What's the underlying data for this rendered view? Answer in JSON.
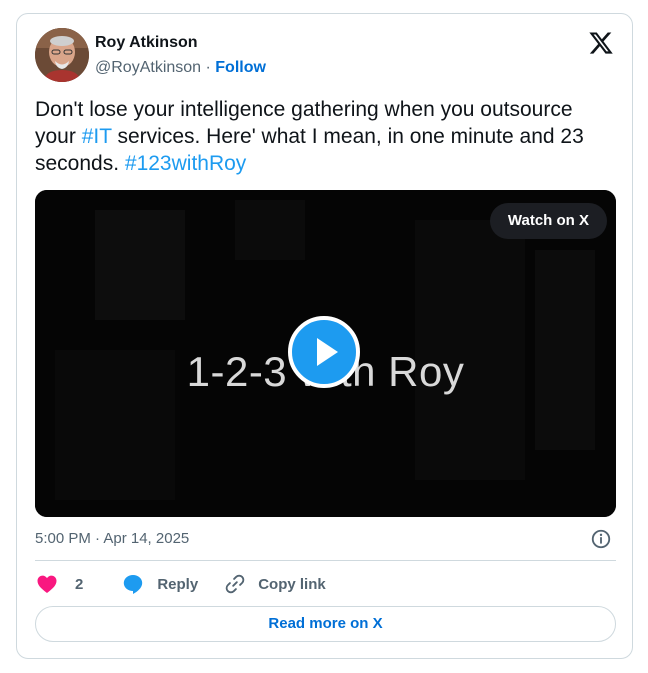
{
  "author": {
    "name": "Roy Atkinson",
    "handle": "@RoyAtkinson",
    "separator": " · ",
    "follow_label": "Follow"
  },
  "tweet": {
    "text_part1": "Don't lose your intelligence gathering when you outsource your ",
    "hashtag1": "#IT",
    "text_part2": " services. Here' what I mean, in one minute and 23 seconds. ",
    "hashtag2": "#123withRoy",
    "timestamp": "5:00 PM · Apr 14, 2025"
  },
  "media": {
    "type": "video",
    "watch_label": "Watch on X",
    "title_overlay": "1-2-3 with Roy"
  },
  "actions": {
    "like_count": "2",
    "reply_label": "Reply",
    "copy_link_label": "Copy link"
  },
  "footer": {
    "read_more_label": "Read more on X"
  },
  "colors": {
    "link": "#1d9bf0",
    "follow": "#006fd6",
    "like": "#f91880",
    "reply": "#1d9bf0",
    "muted": "#536471",
    "border": "#cfd9de"
  },
  "icons": [
    "x-logo-icon",
    "play-icon",
    "info-icon",
    "heart-icon",
    "reply-bubble-icon",
    "link-icon"
  ]
}
